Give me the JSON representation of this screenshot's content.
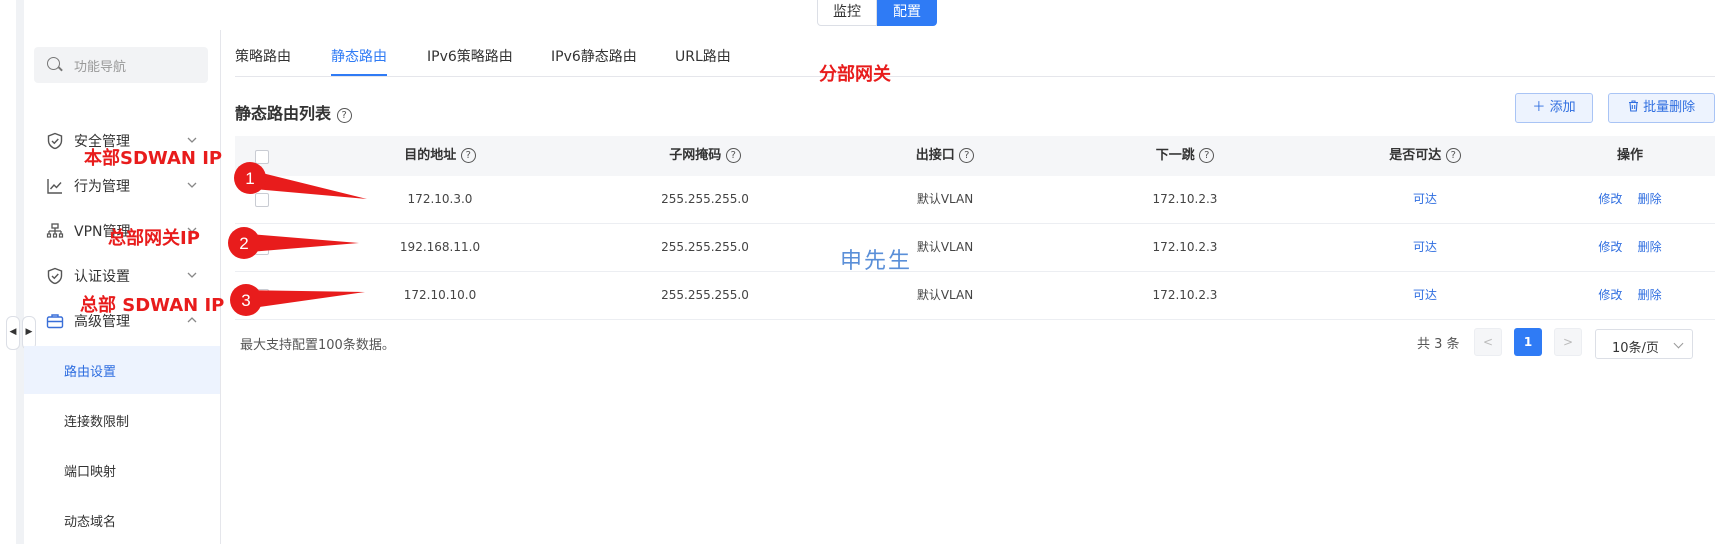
{
  "top_toggle": {
    "monitor": "监控",
    "config": "配置"
  },
  "sidebar": {
    "search_placeholder": "功能导航",
    "menu": [
      {
        "label": "安全管理",
        "icon": "shield-icon"
      },
      {
        "label": "行为管理",
        "icon": "chart-line-icon"
      },
      {
        "label": "VPN管理",
        "icon": "network-icon"
      },
      {
        "label": "认证设置",
        "icon": "shield-check-icon"
      },
      {
        "label": "高级管理",
        "icon": "toolbox-icon"
      }
    ],
    "sub_items": [
      "路由设置",
      "连接数限制",
      "端口映射",
      "动态域名"
    ]
  },
  "tabs": [
    "策略路由",
    "静态路由",
    "IPv6策略路由",
    "IPv6静态路由",
    "URL路由"
  ],
  "page_title": "静态路由列表",
  "toolbar": {
    "add": "添加",
    "batch_delete": "批量删除"
  },
  "table": {
    "headers": [
      "目的地址",
      "子网掩码",
      "出接口",
      "下一跳",
      "是否可达",
      "操作"
    ],
    "rows": [
      {
        "dest": "172.10.3.0",
        "mask": "255.255.255.0",
        "iface": "默认VLAN",
        "next_hop": "172.10.2.3",
        "reachable": "可达",
        "edit": "修改",
        "del": "删除"
      },
      {
        "dest": "192.168.11.0",
        "mask": "255.255.255.0",
        "iface": "默认VLAN",
        "next_hop": "172.10.2.3",
        "reachable": "可达",
        "edit": "修改",
        "del": "删除"
      },
      {
        "dest": "172.10.10.0",
        "mask": "255.255.255.0",
        "iface": "默认VLAN",
        "next_hop": "172.10.2.3",
        "reachable": "可达",
        "edit": "修改",
        "del": "删除"
      }
    ]
  },
  "footer_note": "最大支持配置100条数据。",
  "pagination": {
    "total": "共 3 条",
    "current": "1",
    "page_size": "10条/页"
  },
  "annotations": {
    "branch_gateway": "分部网关",
    "local_sdwan_ip": "本部SDWAN IP",
    "hq_gateway_ip": "总部网关IP",
    "hq_sdwan_ip": "总部 SDWAN IP",
    "markers": [
      "1",
      "2",
      "3"
    ],
    "color": "#e81c1c"
  },
  "watermark": "申先生",
  "colors": {
    "primary": "#2f7bf5",
    "link": "#2f6ee0",
    "annotation": "#e81c1c"
  }
}
